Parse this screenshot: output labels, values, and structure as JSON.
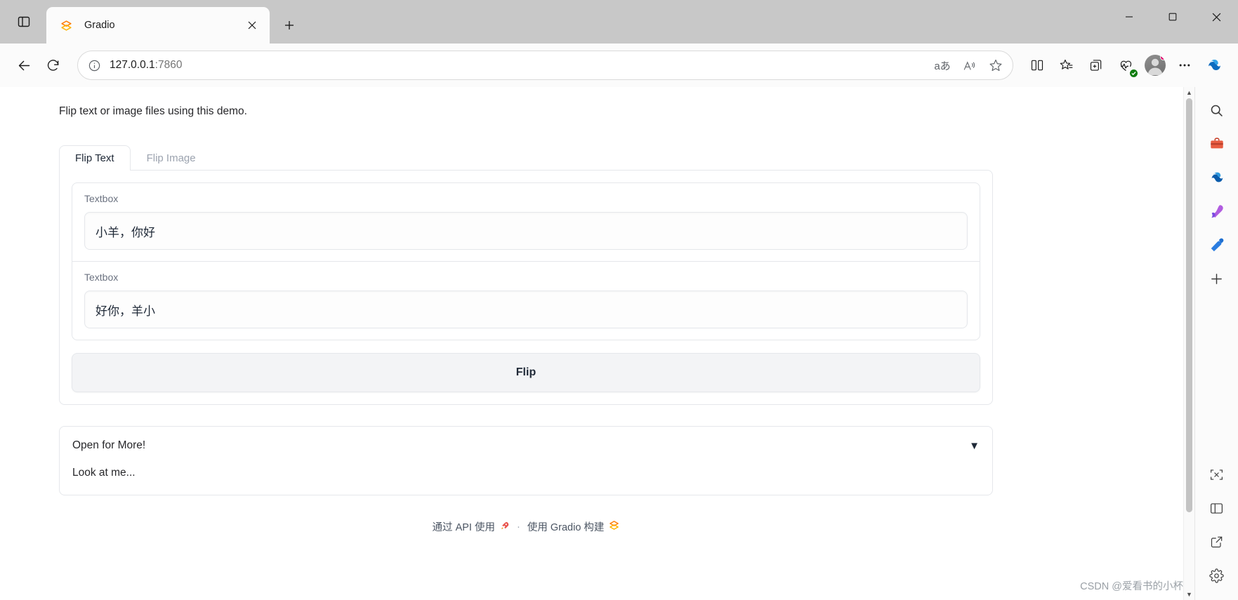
{
  "browser": {
    "tab": {
      "title": "Gradio",
      "favicon_icon": "gradio-logo-icon",
      "close_icon": "close-icon"
    },
    "new_tab_icon": "plus-icon",
    "tab_actions_icon": "tab-actions-icon",
    "window_controls": {
      "minimize_icon": "minimize-icon",
      "maximize_icon": "maximize-icon",
      "close_icon": "window-close-icon"
    },
    "toolbar": {
      "back_icon": "back-arrow-icon",
      "refresh_icon": "refresh-icon",
      "site_info_icon": "info-circle-icon",
      "url": "127.0.0.1",
      "url_port": ":7860",
      "address_icons": [
        {
          "name": "translate-icon",
          "glyph": "aあ"
        },
        {
          "name": "read-aloud-icon",
          "glyph": "A"
        },
        {
          "name": "favorite-star-icon",
          "glyph": "☆"
        }
      ],
      "right_icons": [
        {
          "name": "split-screen-icon"
        },
        {
          "name": "favorites-list-icon"
        },
        {
          "name": "collections-icon"
        },
        {
          "name": "browser-essentials-icon"
        },
        {
          "name": "profile-avatar-icon"
        },
        {
          "name": "settings-more-icon"
        },
        {
          "name": "copilot-icon"
        }
      ]
    },
    "sidebar_icons": [
      {
        "name": "search-icon",
        "glyph": "🔍"
      },
      {
        "name": "shopping-icon",
        "glyph": "🧰"
      },
      {
        "name": "copilot-sidebar-icon",
        "glyph": "🌀"
      },
      {
        "name": "image-creator-icon",
        "glyph": "🎨"
      },
      {
        "name": "games-icon",
        "glyph": "🎮"
      },
      {
        "name": "add-sidebar-icon",
        "glyph": "+"
      },
      {
        "name": "screenshot-icon",
        "glyph": "⛶"
      },
      {
        "name": "split-pane-icon",
        "glyph": "▥"
      },
      {
        "name": "open-external-icon",
        "glyph": "↗"
      },
      {
        "name": "sidebar-settings-icon",
        "glyph": "⚙"
      }
    ]
  },
  "app": {
    "description": "Flip text or image files using this demo.",
    "tabs": [
      {
        "label": "Flip Text",
        "active": true
      },
      {
        "label": "Flip Image",
        "active": false
      }
    ],
    "fields": [
      {
        "label": "Textbox",
        "value": "小羊，你好",
        "placeholder": ""
      },
      {
        "label": "Textbox",
        "value": "好你，羊小",
        "placeholder": ""
      }
    ],
    "submit_button": "Flip",
    "accordion": {
      "title": "Open for More!",
      "arrow_glyph": "▼",
      "body": "Look at me..."
    },
    "footer": {
      "api_link": "通过 API 使用",
      "api_icon": "rocket-icon",
      "separator": "·",
      "built_with": "使用 Gradio 构建",
      "gradio_icon": "gradio-logo-icon"
    },
    "watermark": "CSDN @爱看书的小杯"
  },
  "scrollbar": {
    "up_arrow": "▲",
    "down_arrow": "▼"
  }
}
